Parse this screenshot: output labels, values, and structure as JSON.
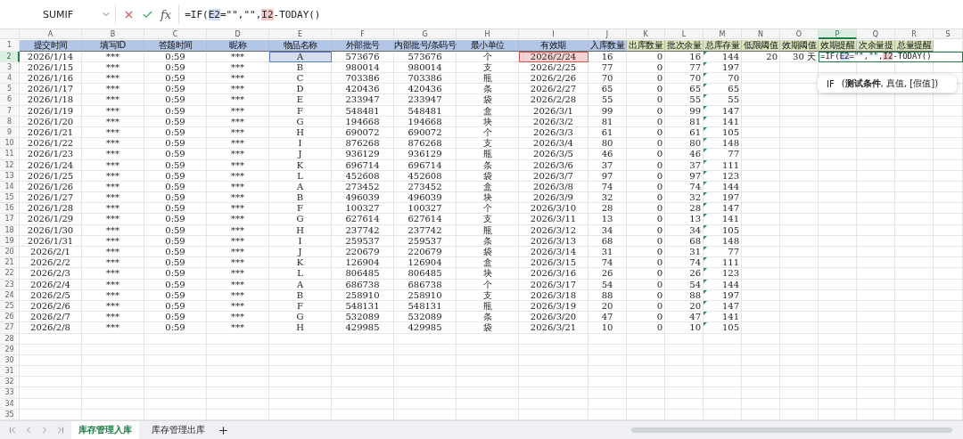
{
  "formula_bar": {
    "name_box": "SUMIF",
    "function_button": "fx",
    "formula": [
      {
        "text": "=IF("
      },
      {
        "text": "E2",
        "color": "#cfdcf3"
      },
      {
        "text": "=\"\",\"\","
      },
      {
        "text": "I2",
        "color": "#f5caca"
      },
      {
        "text": "-TODAY()"
      }
    ]
  },
  "columns": [
    {
      "letter": "A",
      "label": "提交时间",
      "color": "#b4c6e7",
      "selected": false,
      "flagged": false
    },
    {
      "letter": "B",
      "label": "填写ID",
      "color": "#b4c6e7",
      "selected": false,
      "flagged": false
    },
    {
      "letter": "C",
      "label": "答题时间",
      "color": "#b4c6e7",
      "selected": false,
      "flagged": false
    },
    {
      "letter": "D",
      "label": "昵称",
      "color": "#b4c6e7",
      "selected": false,
      "flagged": false
    },
    {
      "letter": "E",
      "label": "物品名称",
      "color": "#b4c6e7",
      "selected": false,
      "flagged": false
    },
    {
      "letter": "F",
      "label": "外部批号",
      "color": "#b4c6e7",
      "selected": false,
      "flagged": false
    },
    {
      "letter": "G",
      "label": "内部批号/条码号",
      "color": "#b4c6e7",
      "selected": false,
      "flagged": false
    },
    {
      "letter": "H",
      "label": "最小单位",
      "color": "#b4c6e7",
      "selected": false,
      "flagged": false
    },
    {
      "letter": "I",
      "label": "有效期",
      "color": "#b4c6e7",
      "selected": false,
      "flagged": false
    },
    {
      "letter": "J",
      "label": "入库数量",
      "color": "#b4c6e7",
      "selected": false,
      "flagged": false
    },
    {
      "letter": "K",
      "label": "出库数量",
      "color": "#d8e4bc",
      "selected": false,
      "flagged": false
    },
    {
      "letter": "L",
      "label": "批次余量",
      "color": "#d8e4bc",
      "selected": false,
      "flagged": false
    },
    {
      "letter": "M",
      "label": "总库存量",
      "color": "#d8e4bc",
      "selected": false,
      "flagged": true
    },
    {
      "letter": "N",
      "label": "低限阈值",
      "color": "#d8e4bc",
      "selected": false,
      "flagged": false
    },
    {
      "letter": "O",
      "label": "效期阈值",
      "color": "#d8e4bc",
      "selected": false,
      "flagged": false
    },
    {
      "letter": "P",
      "label": "效期提醒",
      "color": "#d8e4bc",
      "selected": true,
      "flagged": false
    },
    {
      "letter": "Q",
      "label": "次余量提",
      "color": "#d8e4bc",
      "selected": false,
      "flagged": false
    },
    {
      "letter": "R",
      "label": "总量提醒",
      "color": "#d8e4bc",
      "selected": false,
      "flagged": false
    },
    {
      "letter": "S",
      "selected": false,
      "flagged": false
    }
  ],
  "row_headers": [
    {
      "label": "1",
      "selected": false
    },
    {
      "label": "2",
      "selected": true
    },
    {
      "label": "3",
      "selected": false
    },
    {
      "label": "4",
      "selected": false
    },
    {
      "label": "5",
      "selected": false
    },
    {
      "label": "6",
      "selected": false
    },
    {
      "label": "7",
      "selected": false
    },
    {
      "label": "8",
      "selected": false
    },
    {
      "label": "9",
      "selected": false
    },
    {
      "label": "10",
      "selected": false
    },
    {
      "label": "11",
      "selected": false
    },
    {
      "label": "12",
      "selected": false
    },
    {
      "label": "13",
      "selected": false
    },
    {
      "label": "14",
      "selected": false
    },
    {
      "label": "15",
      "selected": false
    },
    {
      "label": "16",
      "selected": false
    },
    {
      "label": "17",
      "selected": false
    },
    {
      "label": "18",
      "selected": false
    },
    {
      "label": "19",
      "selected": false
    },
    {
      "label": "20",
      "selected": false
    },
    {
      "label": "21",
      "selected": false
    },
    {
      "label": "22",
      "selected": false
    },
    {
      "label": "23",
      "selected": false
    },
    {
      "label": "24",
      "selected": false
    },
    {
      "label": "25",
      "selected": false
    },
    {
      "label": "26",
      "selected": false
    },
    {
      "label": "27",
      "selected": false
    },
    {
      "label": "28",
      "selected": false
    },
    {
      "label": "29",
      "selected": false
    },
    {
      "label": "30",
      "selected": false
    },
    {
      "label": "31",
      "selected": false
    },
    {
      "label": "32",
      "selected": false
    },
    {
      "label": "33",
      "selected": false
    },
    {
      "label": "34",
      "selected": false
    },
    {
      "label": "35",
      "selected": false
    }
  ],
  "rows": [
    [
      "2026/1/14",
      "***",
      "0:59",
      "***",
      {
        "text": "A",
        "color": "#5b7fc7"
      },
      "573676",
      "573676",
      "个",
      {
        "text": "2026/2/24",
        "color": "#d9534f"
      },
      "16",
      "0",
      "16",
      "144",
      "20",
      "30 天",
      {
        "kind": "editing",
        "formula": [
          {
            "text": "=IF("
          },
          {
            "text": "E2",
            "color": "#cfdcf3"
          },
          {
            "text": "=\"\",\"\","
          },
          {
            "text": "I2",
            "color": "#f5caca"
          },
          {
            "text": "-TODAY()"
          }
        ]
      }
    ],
    [
      "2026/1/15",
      "***",
      "0:59",
      "***",
      "B",
      "980014",
      "980014",
      "支",
      "2026/2/25",
      "77",
      "0",
      "77",
      "197"
    ],
    [
      "2026/1/16",
      "***",
      "0:59",
      "***",
      "C",
      "703386",
      "703386",
      "瓶",
      "2026/2/26",
      "70",
      "0",
      "70",
      "70"
    ],
    [
      "2026/1/17",
      "***",
      "0:59",
      "***",
      "D",
      "420436",
      "420436",
      "条",
      "2026/2/27",
      "65",
      "0",
      "65",
      "65"
    ],
    [
      "2026/1/18",
      "***",
      "0:59",
      "***",
      "E",
      "233947",
      "233947",
      "袋",
      "2026/2/28",
      "55",
      "0",
      "55",
      "55"
    ],
    [
      "2026/1/19",
      "***",
      "0:59",
      "***",
      "F",
      "548481",
      "548481",
      "盒",
      "2026/3/1",
      "99",
      "0",
      "99",
      "147"
    ],
    [
      "2026/1/20",
      "***",
      "0:59",
      "***",
      "G",
      "194668",
      "194668",
      "块",
      "2026/3/2",
      "81",
      "0",
      "81",
      "141"
    ],
    [
      "2026/1/21",
      "***",
      "0:59",
      "***",
      "H",
      "690072",
      "690072",
      "个",
      "2026/3/3",
      "61",
      "0",
      "61",
      "105"
    ],
    [
      "2026/1/22",
      "***",
      "0:59",
      "***",
      "I",
      "876268",
      "876268",
      "支",
      "2026/3/4",
      "80",
      "0",
      "80",
      "148"
    ],
    [
      "2026/1/23",
      "***",
      "0:59",
      "***",
      "J",
      "936129",
      "936129",
      "瓶",
      "2026/3/5",
      "46",
      "0",
      "46",
      "77"
    ],
    [
      "2026/1/24",
      "***",
      "0:59",
      "***",
      "K",
      "696714",
      "696714",
      "条",
      "2026/3/6",
      "37",
      "0",
      "37",
      "111"
    ],
    [
      "2026/1/25",
      "***",
      "0:59",
      "***",
      "L",
      "452608",
      "452608",
      "袋",
      "2026/3/7",
      "97",
      "0",
      "97",
      "123"
    ],
    [
      "2026/1/26",
      "***",
      "0:59",
      "***",
      "A",
      "273452",
      "273452",
      "盒",
      "2026/3/8",
      "74",
      "0",
      "74",
      "144"
    ],
    [
      "2026/1/27",
      "***",
      "0:59",
      "***",
      "B",
      "496039",
      "496039",
      "块",
      "2026/3/9",
      "32",
      "0",
      "32",
      "197"
    ],
    [
      "2026/1/28",
      "***",
      "0:59",
      "***",
      "F",
      "100327",
      "100327",
      "个",
      "2026/3/10",
      "28",
      "0",
      "28",
      "147"
    ],
    [
      "2026/1/29",
      "***",
      "0:59",
      "***",
      "G",
      "627614",
      "627614",
      "支",
      "2026/3/11",
      "13",
      "0",
      "13",
      "141"
    ],
    [
      "2026/1/30",
      "***",
      "0:59",
      "***",
      "H",
      "237742",
      "237742",
      "瓶",
      "2026/3/12",
      "34",
      "0",
      "34",
      "105"
    ],
    [
      "2026/1/31",
      "***",
      "0:59",
      "***",
      "I",
      "259537",
      "259537",
      "条",
      "2026/3/13",
      "68",
      "0",
      "68",
      "148"
    ],
    [
      "2026/2/1",
      "***",
      "0:59",
      "***",
      "J",
      "220679",
      "220679",
      "袋",
      "2026/3/14",
      "31",
      "0",
      "31",
      "77"
    ],
    [
      "2026/2/2",
      "***",
      "0:59",
      "***",
      "K",
      "126904",
      "126904",
      "盒",
      "2026/3/15",
      "74",
      "0",
      "74",
      "111"
    ],
    [
      "2026/2/3",
      "***",
      "0:59",
      "***",
      "L",
      "806485",
      "806485",
      "块",
      "2026/3/16",
      "26",
      "0",
      "26",
      "123"
    ],
    [
      "2026/2/4",
      "***",
      "0:59",
      "***",
      "A",
      "686738",
      "686738",
      "个",
      "2026/3/17",
      "54",
      "0",
      "54",
      "144"
    ],
    [
      "2026/2/5",
      "***",
      "0:59",
      "***",
      "B",
      "258910",
      "258910",
      "支",
      "2026/3/18",
      "88",
      "0",
      "88",
      "197"
    ],
    [
      "2026/2/6",
      "***",
      "0:59",
      "***",
      "F",
      "548131",
      "548131",
      "瓶",
      "2026/3/19",
      "20",
      "0",
      "20",
      "147"
    ],
    [
      "2026/2/7",
      "***",
      "0:59",
      "***",
      "G",
      "532089",
      "532089",
      "条",
      "2026/3/20",
      "47",
      "0",
      "47",
      "141"
    ],
    [
      "2026/2/8",
      "***",
      "0:59",
      "***",
      "H",
      "429985",
      "429985",
      "袋",
      "2026/3/21",
      "10",
      "0",
      "10",
      "105"
    ]
  ],
  "tooltip": {
    "name": "IF",
    "args": "(**测试条件**, 真值, [假值])"
  },
  "sheet_tabs": [
    {
      "label": "库存管理入库",
      "selected": true
    },
    {
      "label": "库存管理出库",
      "selected": false
    }
  ]
}
